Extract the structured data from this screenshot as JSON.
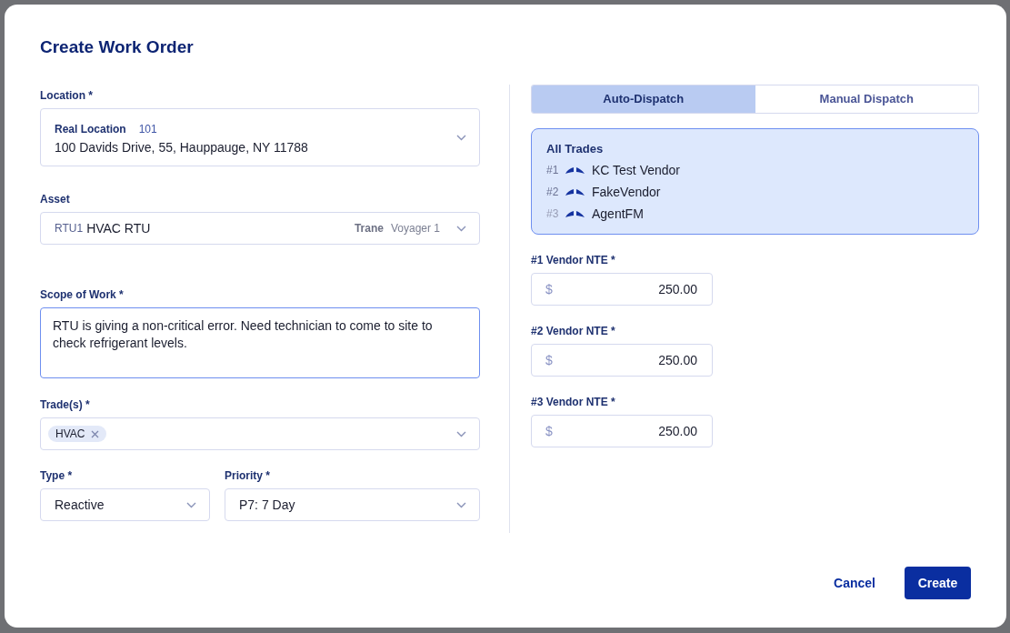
{
  "dialog": {
    "title": "Create Work Order"
  },
  "location": {
    "label": "Location *",
    "name": "Real Location",
    "code": "101",
    "address": "100 Davids Drive, 55, Hauppauge, NY 11788"
  },
  "asset": {
    "label": "Asset",
    "code": "RTU1",
    "name": "HVAC RTU",
    "make": "Trane",
    "model": "Voyager 1"
  },
  "scope": {
    "label": "Scope of Work *",
    "value": "RTU is giving a non-critical error. Need technician to come to site to check refrigerant levels."
  },
  "trades": {
    "label": "Trade(s) *",
    "tags": [
      "HVAC"
    ]
  },
  "type": {
    "label": "Type *",
    "value": "Reactive"
  },
  "priority": {
    "label": "Priority *",
    "value": "P7: 7 Day"
  },
  "dispatch_tabs": [
    {
      "label": "Auto-Dispatch",
      "selected": true
    },
    {
      "label": "Manual Dispatch",
      "selected": false
    }
  ],
  "vendors": {
    "title": "All Trades",
    "items": [
      {
        "rank": "#1",
        "name": "KC Test Vendor"
      },
      {
        "rank": "#2",
        "name": "FakeVendor"
      },
      {
        "rank": "#3",
        "name": "AgentFM"
      }
    ]
  },
  "nte_fields": [
    {
      "label": "#1 Vendor NTE *",
      "currency": "$",
      "value": "250.00"
    },
    {
      "label": "#2 Vendor NTE *",
      "currency": "$",
      "value": "250.00"
    },
    {
      "label": "#3 Vendor NTE *",
      "currency": "$",
      "value": "250.00"
    }
  ],
  "buttons": [
    {
      "label": "Cancel",
      "kind": "secondary"
    },
    {
      "label": "Create",
      "kind": "primary"
    }
  ]
}
